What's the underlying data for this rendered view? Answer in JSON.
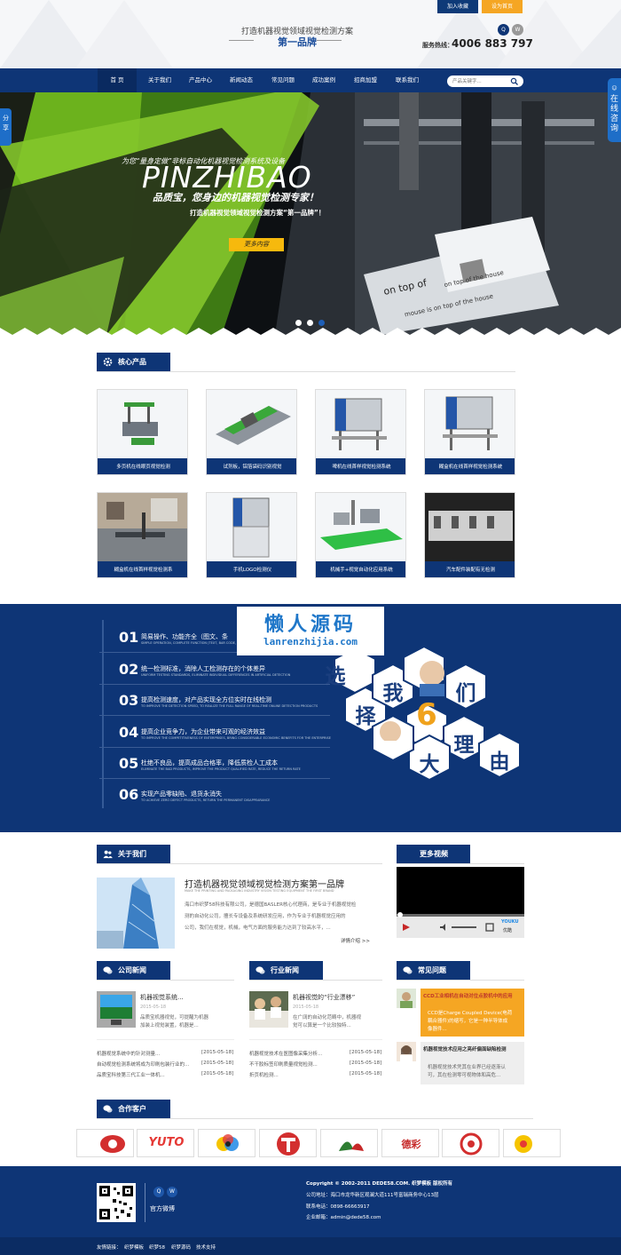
{
  "header": {
    "top_links": [
      "加入收藏",
      "设为首页"
    ],
    "slogan_line1": "打造机器视觉领域视觉检测方案",
    "slogan_line2": "第一品牌",
    "hotline_label": "服务热线：",
    "hotline_number": "4006 883 797"
  },
  "nav": {
    "items": [
      "首 页",
      "关于我们",
      "产品中心",
      "新闻动态",
      "常见问题",
      "成功案例",
      "招商加盟",
      "联系我们"
    ],
    "search_placeholder": "产品关键字..."
  },
  "side": {
    "share": "分享",
    "consult": "在线咨询"
  },
  "banner": {
    "line1": "为您“量身定做”非标自动化机器视觉检测系统及设备",
    "brand": "PINZHIBAO",
    "line2": "品质宝，您身边的机器视觉检测专家！",
    "line3": "打造机器视觉领域视觉检测方案“第一品牌”！",
    "button": "更多内容",
    "photo_text1": "on top of",
    "photo_text2": "on top of the house",
    "photo_text3": "mouse is on top of the house",
    "slides": 3,
    "active_slide": 3
  },
  "products": {
    "title": "核心产品",
    "items": [
      "多页机在线眼页视觉检测",
      "试剂板，铝箔袋码识别视觉",
      "啤机在线首样视觉检测系统",
      "糊盒机在线首样视觉检测系统",
      "糊盒机在线首样视觉检测系",
      "手机LOGO检测仪",
      "机械手+视觉自动化应用系统",
      "汽车配件装配有无检测"
    ]
  },
  "reasons": {
    "items": [
      {
        "num": "01",
        "title": "简易操作、功能齐全（图文、条",
        "sub": "SIMPLE OPERATION, COMPLETE FUNCTION (TEXT, BAR CODE, QR CODE"
      },
      {
        "num": "02",
        "title": "统一检测标准，消除人工检测存在的个体差异",
        "sub": "UNIFORM TESTING STANDARDS, ELIMINATE INDIVIDUAL DIFFERENCES IN ARTIFICIAL DETECTION"
      },
      {
        "num": "03",
        "title": "提高检测速度，对产品实现全方位实时在线检测",
        "sub": "TO IMPROVE THE DETECTION SPEED, TO REALIZE THE FULL RANGE OF REAL-TIME ONLINE DETECTION PRODUCTS"
      },
      {
        "num": "04",
        "title": "提高企业竞争力，为企业带来可观的经济效益",
        "sub": "TO IMPROVE THE COMPETITIVENESS OF ENTERPRISES, BRING CONSIDERABLE ECONOMIC BENEFITS FOR THE ENTERPRISE"
      },
      {
        "num": "05",
        "title": "杜绝不良品，提高成品合格率，降低质检人工成本",
        "sub": "ELIMINATE THE BAD PRODUCTS, IMPROVE THE PRODUCT QUALIFIED RATE, REDUCE THE RETURN RATE"
      },
      {
        "num": "06",
        "title": "实现产品零缺陷、退货永消失",
        "sub": "TO ACHIEVE ZERO DEFECT PRODUCTS, RETURN THE PERMANENT DISAPPEARANCE"
      }
    ],
    "hex_chars": [
      "选",
      "择",
      "我",
      "6",
      "们",
      "大",
      "理",
      "由"
    ],
    "watermark_cn": "懒人源码",
    "watermark_en": "lanrenzhijia.com"
  },
  "about": {
    "title": "关于我们",
    "heading": "打造机器视觉领域视觉检测方案第一品牌",
    "heading_en": "MAKE THE PRINTING AND PACKAGING INDUSTRY VISION TESTING EQUIPMENT THE FIRST BRAND",
    "body": [
      "海口市织梦58科技有限公司，是德国BASLER核心代理商，是专业于机器视觉检",
      "测的自动化公司，擅长专设备及系统研发应用，作为专业于机器视觉应用的",
      "公司，我们在视觉，机械，电气方面的服务能力达到了较高水平，..."
    ],
    "more": "详情介绍 >>"
  },
  "video": {
    "title": "更多视频",
    "logo_top": "YOUKU",
    "logo_bottom": "优酷"
  },
  "company_news": {
    "title": "公司新闻",
    "featured_title": "机器视觉系统...",
    "featured_date": "2015-05-18",
    "featured_desc": [
      "品质宝机器视觉，可提醒为机器",
      "加装上视觉装置，机器是..."
    ],
    "items": [
      {
        "t": "机器视觉系统中的针对测量...",
        "d": "[2015-05-18]"
      },
      {
        "t": "自动视觉检测系统将成为印刷包装行业的...",
        "d": "[2015-05-18]"
      },
      {
        "t": "品质宝科技第三代工业一体机...",
        "d": "[2015-05-18]"
      }
    ]
  },
  "industry_news": {
    "title": "行业新闻",
    "featured_title": "机器视觉的“行业漂移”",
    "featured_date": "2015-05-18",
    "featured_desc": [
      "在广阔的自动化范畴中，机器视",
      "觉可以算是一个比较独特..."
    ],
    "items": [
      {
        "t": "机器视觉技术在医图像采集分析...",
        "d": "[2015-05-18]"
      },
      {
        "t": "不干胶标签印刷质量视觉检测...",
        "d": "[2015-05-18]"
      },
      {
        "t": "折页机检测...",
        "d": "[2015-05-18]"
      }
    ]
  },
  "faq": {
    "title": "常见问题",
    "q1_title": "CCD工业相机在自动对位点胶机中的应用",
    "q1_body": [
      "CCD是Charge Coupled Device(电荷",
      "耦合器件)的缩写，它是一种半导体成",
      "像器件..."
    ],
    "q2_title": "机器视觉技术应用之亮纤偏面缺陷检测",
    "q2_body": [
      "机器视觉技术凭其在业界已经逐渐认",
      "可，其在检测零可视物体和高危..."
    ]
  },
  "partners": {
    "title": "合作客户",
    "logos": [
      "",
      "YUTO",
      "",
      "",
      "",
      "德彩",
      "",
      ""
    ]
  },
  "footer": {
    "weibo_label": "官方微博",
    "copyright": "Copyright © 2002-2011 DEDE58.COM. 织梦模板 版权所有",
    "address": "公司地址：海口市龙华新区观澜大道111号富瑞商务中心13层",
    "phone": "联系电话：0898-66663917",
    "email": "企业邮箱：admin@dede58.com",
    "friend_label": "友情链接：",
    "friend_links": [
      "织梦模板",
      "织梦58",
      "织梦源码",
      "技术支持"
    ]
  }
}
